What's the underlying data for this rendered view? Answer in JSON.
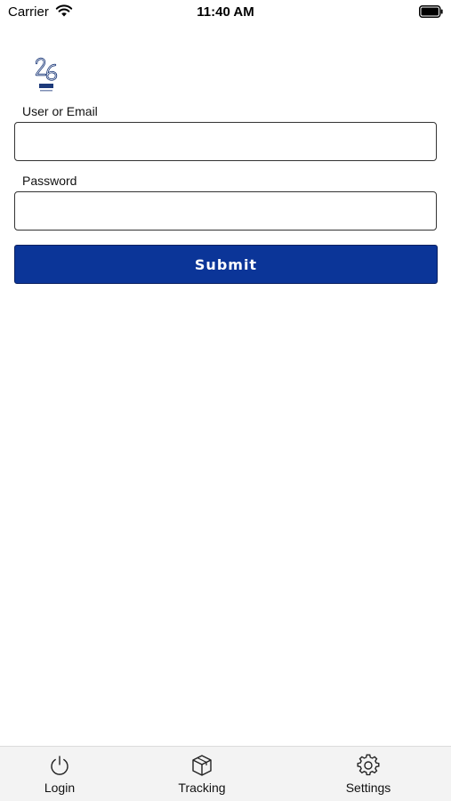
{
  "status_bar": {
    "carrier": "Carrier",
    "time": "11:40 AM",
    "icons": [
      "wifi-icon",
      "battery-icon"
    ]
  },
  "logo": {
    "icon": "logo-26-icon"
  },
  "form": {
    "user_label": "User or Email",
    "user_value": "",
    "user_placeholder": "",
    "password_label": "Password",
    "password_value": "",
    "password_placeholder": "",
    "submit_label": "Submit"
  },
  "tabs": [
    {
      "label": "Login",
      "icon": "power-icon"
    },
    {
      "label": "Tracking",
      "icon": "package-box-icon"
    },
    {
      "label": "Settings",
      "icon": "gear-icon"
    }
  ],
  "colors": {
    "accent": "#0b3598",
    "tab_bar_bg": "#f3f3f3"
  }
}
